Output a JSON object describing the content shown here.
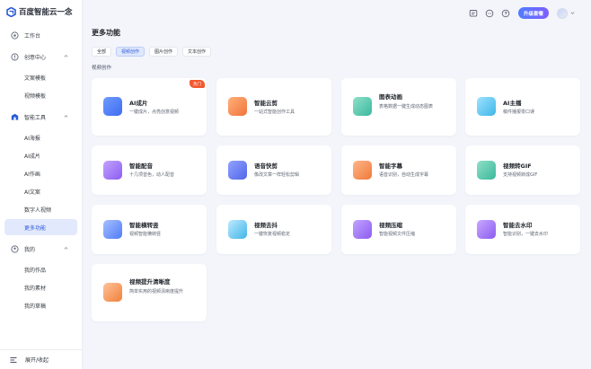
{
  "app": {
    "logo_text": "百度智能云一念"
  },
  "header": {
    "upgrade_label": "升级套餐"
  },
  "sidebar": {
    "items": [
      {
        "label": "工作台",
        "level": "top",
        "icon": "desktop-icon"
      },
      {
        "label": "创意中心",
        "level": "top",
        "icon": "lightbulb-icon",
        "expanded": true
      },
      {
        "label": "文案模板",
        "level": "sub"
      },
      {
        "label": "视频模板",
        "level": "sub"
      },
      {
        "label": "智能工具",
        "level": "top",
        "icon": "toolbox-icon",
        "expanded": true
      },
      {
        "label": "AI海报",
        "level": "sub"
      },
      {
        "label": "AI成片",
        "level": "sub"
      },
      {
        "label": "AI作画",
        "level": "sub"
      },
      {
        "label": "AI文案",
        "level": "sub"
      },
      {
        "label": "数字人视频",
        "level": "sub"
      },
      {
        "label": "更多功能",
        "level": "sub",
        "active": true
      },
      {
        "label": "我的",
        "level": "top",
        "icon": "user-icon",
        "expanded": true
      },
      {
        "label": "我的作品",
        "level": "sub"
      },
      {
        "label": "我的素材",
        "level": "sub"
      },
      {
        "label": "我的草稿",
        "level": "sub"
      }
    ],
    "footer_label": "展开/收起"
  },
  "main": {
    "title": "更多功能",
    "tabs": [
      {
        "label": "全部",
        "active": false
      },
      {
        "label": "视频创作",
        "active": true
      },
      {
        "label": "图片创作",
        "active": false
      },
      {
        "label": "文本创作",
        "active": false
      }
    ],
    "section_label": "视频创作",
    "cards": [
      {
        "title": "AI成片",
        "desc": "一键成片，点亮创意视频",
        "badge": "热门",
        "icon": "ai-film-icon",
        "color": "#4f7cf7"
      },
      {
        "title": "智能云剪",
        "desc": "一站式智能创作工具",
        "icon": "crop-icon",
        "color": "#f0733a"
      },
      {
        "title": "图表动画",
        "desc": "表格数据一键生成动态图表",
        "icon": "chart-animation-icon",
        "color": "#3bb8a0"
      },
      {
        "title": "AI主播",
        "desc": "稿件播报零口误",
        "icon": "ai-anchor-icon",
        "color": "#3fb6e8"
      },
      {
        "title": "智能配音",
        "desc": "十几项音色，动人配音",
        "icon": "voice-wave-icon",
        "color": "#8c5cf0"
      },
      {
        "title": "语音快剪",
        "desc": "像改文章一样轻松剪辑",
        "icon": "crop-icon",
        "color": "#4f66e8"
      },
      {
        "title": "智能字幕",
        "desc": "语音识别，自动生成字幕",
        "icon": "subtitle-icon",
        "color": "#f07a3a"
      },
      {
        "title": "视频转GIF",
        "desc": "支持视频转成GIF",
        "icon": "gif-icon",
        "color": "#3bb89a"
      },
      {
        "title": "智能横转竖",
        "desc": "视频智能横转竖",
        "icon": "rotate-icon",
        "color": "#4f7cf7"
      },
      {
        "title": "视频去抖",
        "desc": "一键恢复视频稳定",
        "icon": "stabilize-icon",
        "color": "#3fb6e8"
      },
      {
        "title": "视频压缩",
        "desc": "智能视频文件压缩",
        "icon": "compress-icon",
        "color": "#8c5cf0"
      },
      {
        "title": "智能去水印",
        "desc": "智能识别，一键去水印",
        "icon": "watermark-icon",
        "color": "#8a5cf0"
      },
      {
        "title": "视频提升清晰度",
        "desc": "简单实用的视频清晰度提升",
        "icon": "hd-icon",
        "color": "#f0803a"
      }
    ]
  }
}
